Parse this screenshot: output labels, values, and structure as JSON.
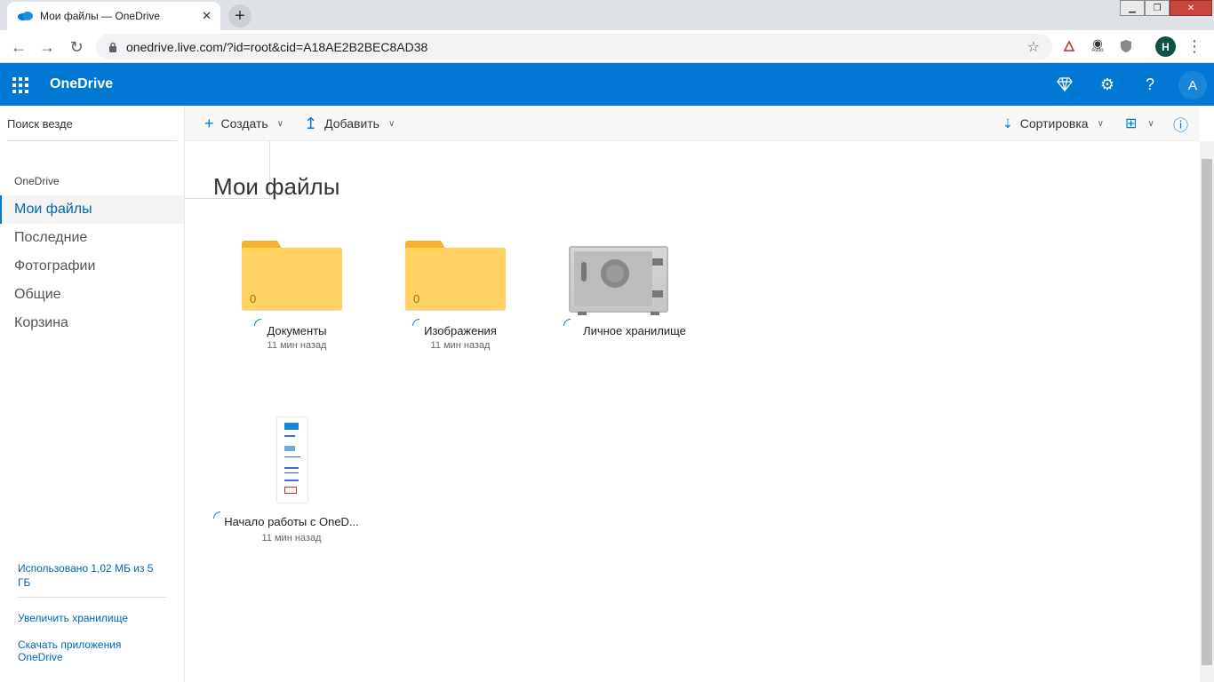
{
  "browser": {
    "tab_title": "Мои файлы — OneDrive",
    "url": "onedrive.live.com/?id=root&cid=A18AE2B2BEC8AD38",
    "profile_initial": "H",
    "extension_label": "Avito"
  },
  "suite": {
    "brand": "OneDrive",
    "avatar_initial": "A",
    "icons": [
      "waffle-icon",
      "premium-diamond-icon",
      "settings-gear-icon",
      "help-icon"
    ]
  },
  "leftnav": {
    "search_placeholder": "Поиск везде",
    "section": "OneDrive",
    "items": [
      {
        "label": "Мои файлы",
        "active": true
      },
      {
        "label": "Последние",
        "active": false
      },
      {
        "label": "Фотографии",
        "active": false
      },
      {
        "label": "Общие",
        "active": false
      },
      {
        "label": "Корзина",
        "active": false
      }
    ],
    "quota": "Использовано 1,02 МБ из 5 ГБ",
    "upgrade": "Увеличить хранилище",
    "get_apps": "Скачать приложения OneDrive"
  },
  "commands": {
    "create": "Создать",
    "add": "Добавить",
    "sort": "Сортировка"
  },
  "main": {
    "title": "Мои файлы",
    "items": [
      {
        "name": "Документы",
        "date": "11 мин назад",
        "count": "0",
        "type": "folder"
      },
      {
        "name": "Изображения",
        "date": "11 мин назад",
        "count": "0",
        "type": "folder"
      },
      {
        "name": "Личное хранилище",
        "date": "",
        "type": "vault"
      },
      {
        "name": "Начало работы с OneD...",
        "date": "11 мин назад",
        "type": "document"
      }
    ]
  },
  "colors": {
    "suite_bar": "#0078d4",
    "accent_text": "#0067b8",
    "folder": "#ffd262"
  }
}
